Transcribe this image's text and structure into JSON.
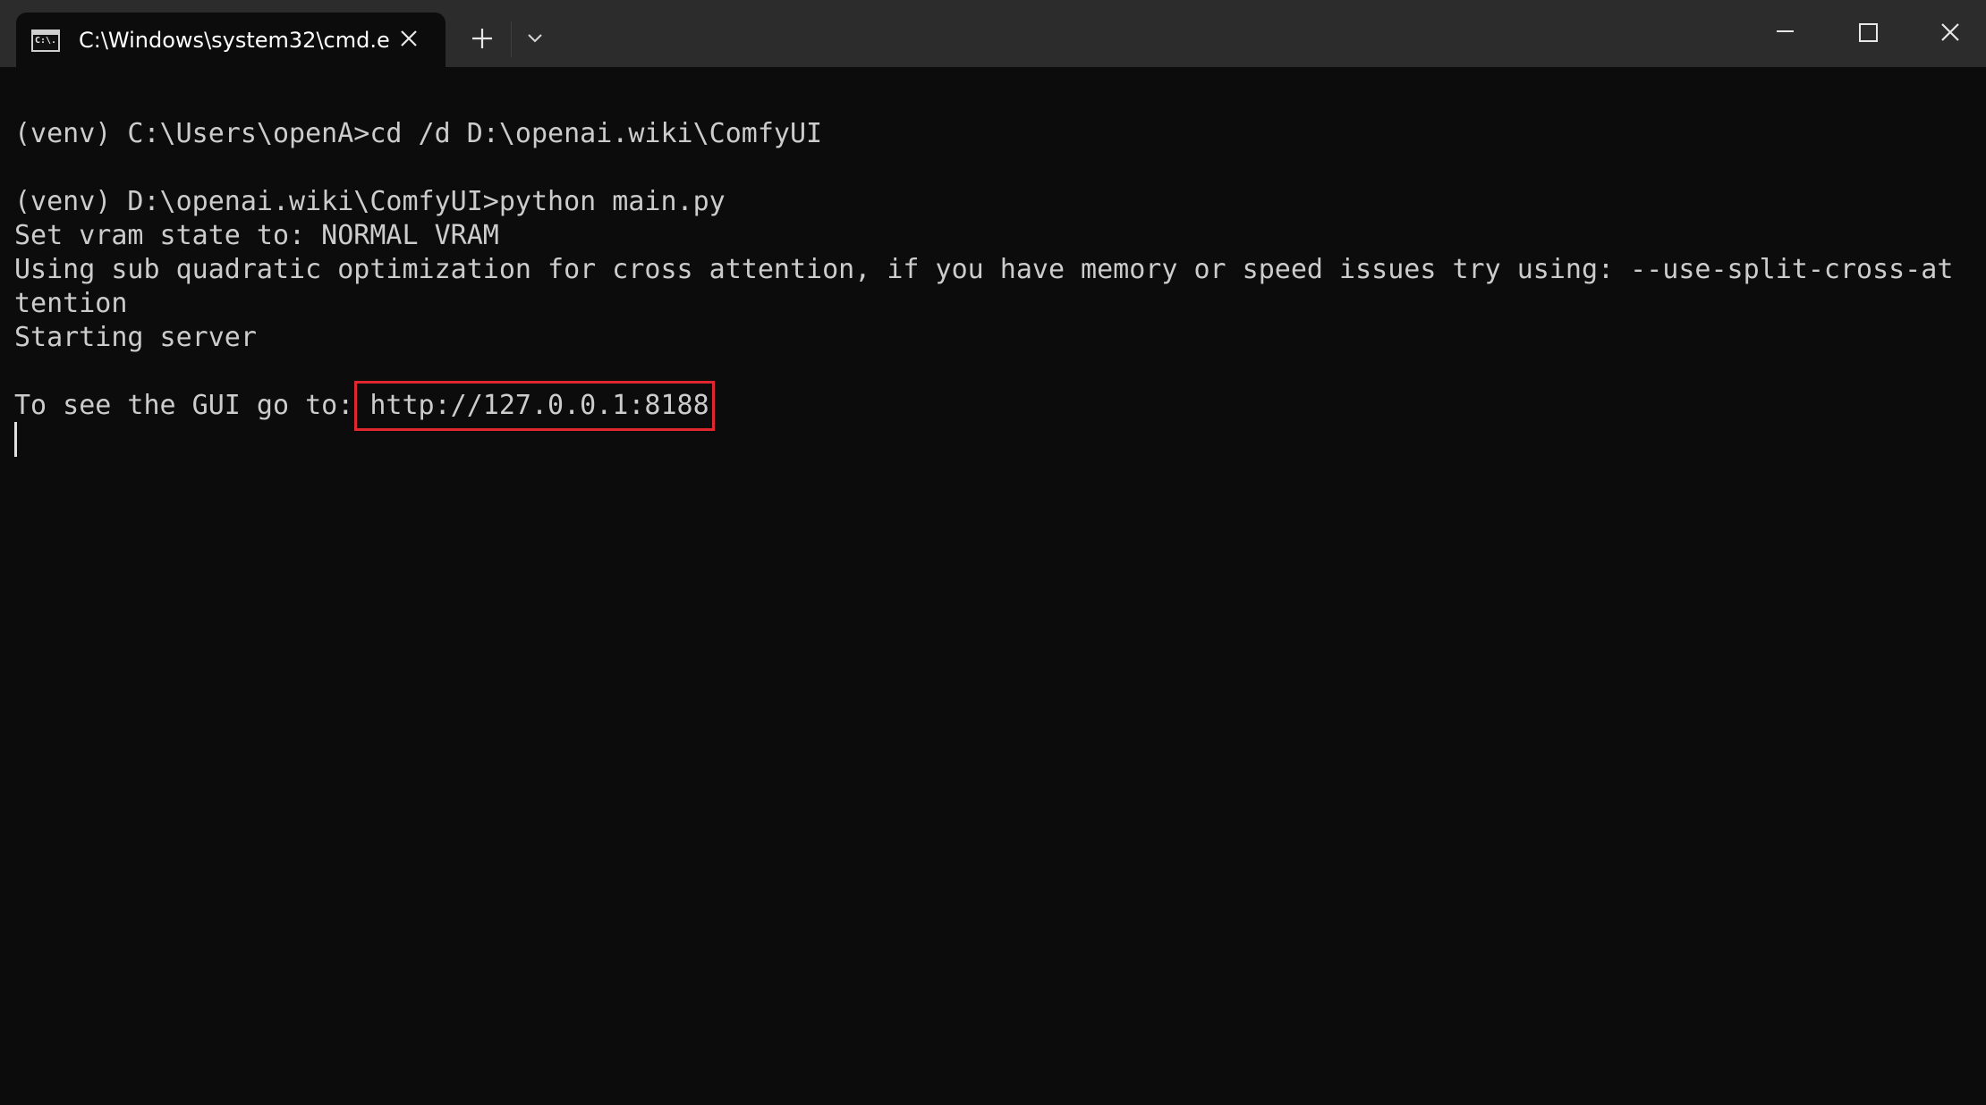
{
  "window": {
    "tab": {
      "icon": "cmd-icon",
      "icon_text": "C:\\.",
      "title": "C:\\Windows\\system32\\cmd.e:",
      "close_label": "✕"
    },
    "new_tab_label": "+",
    "dropdown_icon": "chevron-down-icon",
    "controls": {
      "minimize": "minimize-icon",
      "maximize": "maximize-icon",
      "close": "close-icon"
    }
  },
  "terminal": {
    "lines": [
      "(venv) C:\\Users\\openA>cd /d D:\\openai.wiki\\ComfyUI",
      "",
      "(venv) D:\\openai.wiki\\ComfyUI>python main.py",
      "Set vram state to: NORMAL VRAM",
      "Using sub quadratic optimization for cross attention, if you have memory or speed issues try using: --use-split-cross-at",
      "tention",
      "Starting server",
      "",
      "To see the GUI go to: http://127.0.0.1:8188"
    ],
    "highlighted_url": "http://127.0.0.1:8188",
    "highlight_color": "#e0262f"
  }
}
